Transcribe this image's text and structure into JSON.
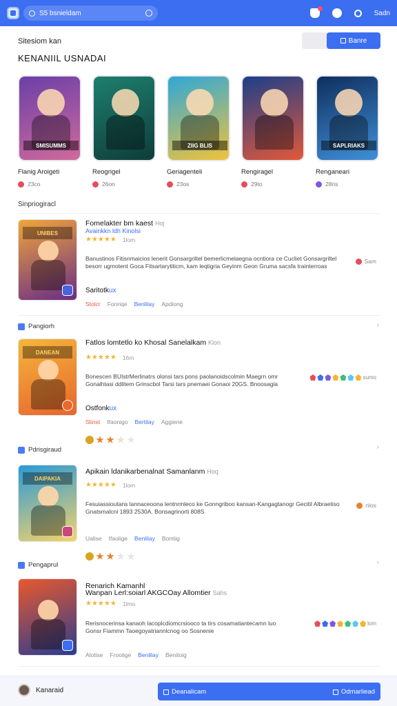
{
  "header": {
    "search_placeholder": "S5 bsnieldam",
    "link": "Sadn"
  },
  "section": {
    "label": "Sitesiom kan",
    "toggle_label": "Banre",
    "title": "KENANIIL USNADAI"
  },
  "featured": [
    {
      "name": "Flanig Aroigeti",
      "meta": "23co",
      "band": "SMISUMMS",
      "bg": "linear-gradient(160deg,#6b3fa8,#d06a9c)",
      "dot": "#e84c5b"
    },
    {
      "name": "Reogrigel",
      "meta": "26on",
      "band": "",
      "bg": "linear-gradient(160deg,#1d7f6e,#0f3d3a)",
      "dot": "#e84c5b"
    },
    {
      "name": "Geriagenteli",
      "meta": "23os",
      "band": "ZIIG BLIS",
      "bg": "linear-gradient(160deg,#2fa8d8,#f0c33c)",
      "dot": "#e84c5b"
    },
    {
      "name": "Rengiragel",
      "meta": "29to",
      "band": "",
      "bg": "linear-gradient(160deg,#1c3e8a,#e2583a)",
      "dot": "#e84c5b"
    },
    {
      "name": "Renganeari",
      "meta": "28ris",
      "band": "SAPLRIAKS",
      "bg": "linear-gradient(160deg,#0f2f5e,#3f8fd8)",
      "dot": "#7b5adf"
    }
  ],
  "list_label": "Sinpriogiracl",
  "items": [
    {
      "title": "Fomelakter bm kaest",
      "title_muted": "Hoj",
      "link": "Avainkkn ldh Kinolsi",
      "rating": "1lom",
      "desc": "Banustinos Fitisnmaicios lenerit Gonsargriltel bemerlicmelaegna ocntiora ce Cucliet Gonsargriltel besorr ugmotent Goca Fitsartarytiticm, kam leqtigria Geyinm Geon Gruma sacsfa trainterroas",
      "side": "Sam",
      "tag": "Saritotk",
      "tag_acc": "ux",
      "actions": [
        "Stolcr",
        "Fonriqe",
        "Benlilay",
        "Apdiong"
      ],
      "thumb_band": "UNIBES",
      "bg": "linear-gradient(160deg,#f0a53a,#6a2d85)"
    },
    {
      "title": "Fatlos lomtetlo ko Khosal Sanelalkam",
      "title_muted": "Klon",
      "rating": "16m",
      "desc": "Bonescen BUIstrMerlinatrs olonsi tars pons paolanoidscolmin Maegrn omr Gonalhtasi ddlitem Grinscbol Tarsi tars pnemaei Gonaoi 20GS. Bnoosagia",
      "side": "sumo",
      "tag": "Ostfonk",
      "tag_acc": "ux",
      "actions": [
        "Stinst",
        "Ifaonigo",
        "Bertilay",
        "Aggiene"
      ],
      "thumb_band": "DANEAN",
      "bg": "linear-gradient(160deg,#f4b63c,#e8652d)"
    },
    {
      "title": "Apikain ldanikarbenalnat Samanlanm",
      "title_muted": "Hoq",
      "rating": "1lom",
      "desc": "Fesuiassioutans lannaceoona lentnrmleco ke Gonngriboo kansan-Kangagtanogr Gecitil Albraetiso Gnatsmalcni 1893 2530A. Bonsagrinorti 808S",
      "side": "nlos",
      "tag": "",
      "tag_acc": "",
      "actions": [
        "Ualise",
        "Ifaolige",
        "Benlilay",
        "Bontiig"
      ],
      "thumb_band": "DAIPAKIA",
      "bg": "linear-gradient(160deg,#2a9ad8,#f5d36a)"
    },
    {
      "title": "Renarich Kamanhl",
      "title_muted": "",
      "rating": "1lmo",
      "title2": "Wanpan Lerl:soiarl AKGCOay Allomtier",
      "title2_muted": "Sahs",
      "desc": "Rerisnocerinsa kanaoh lacoplcdiomcrsiooco ta tirs cosamatiantecamn luo Gonsr Fiammn Taoegoyatriannlcnog oo Sosnenie",
      "side": "lom",
      "tag": "",
      "tag_acc": "",
      "actions": [
        "Alotise",
        "Froolige",
        "Benlilay",
        "Benitoig"
      ],
      "thumb_band": "",
      "bg": "linear-gradient(160deg,#e8582e,#2a3d8f)"
    }
  ],
  "groups": [
    "Pangiorh",
    "Pdrisgiraud",
    "Pengaprul"
  ],
  "footer": {
    "user": "Kanaraid",
    "primary_left": "Deanalicam",
    "primary_right": "Odmarliead"
  },
  "colors": {
    "accent": "#3b6ef0",
    "star": "#f2b632"
  }
}
